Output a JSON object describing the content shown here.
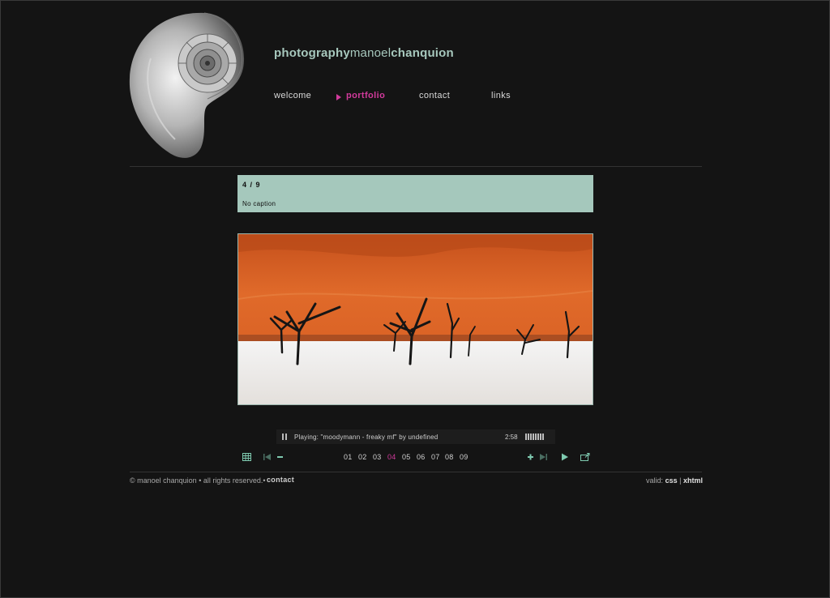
{
  "header": {
    "title_bold_1": "photography",
    "title_light": "manoel",
    "title_bold_2": "chanquion"
  },
  "nav": [
    {
      "label": "welcome",
      "active": false
    },
    {
      "label": "portfolio",
      "active": true
    },
    {
      "label": "contact",
      "active": false
    },
    {
      "label": "links",
      "active": false
    }
  ],
  "gallery": {
    "counter": "4 / 9",
    "caption": "No caption",
    "pages": [
      "01",
      "02",
      "03",
      "04",
      "05",
      "06",
      "07",
      "08",
      "09"
    ],
    "current_page": "04"
  },
  "player": {
    "now_playing": "Playing: \"moodymann - freaky mf\" by undefined",
    "time": "2:58"
  },
  "icons": {
    "pause": "pause-icon",
    "grid": "grid-icon",
    "first": "skip-first-icon",
    "zoom_out": "minus-icon",
    "zoom_in": "plus-icon",
    "last": "skip-last-icon",
    "play": "play-icon",
    "fullscreen": "popout-icon"
  },
  "footer": {
    "copyright": "© manoel chanquion • all rights reserved.•",
    "contact": "contact",
    "valid_label": "valid:",
    "css": "css",
    "separator": "|",
    "xhtml": "xhtml"
  },
  "colors": {
    "background": "#141414",
    "accent": "#d23a9c",
    "mint": "#a5c8bc"
  }
}
